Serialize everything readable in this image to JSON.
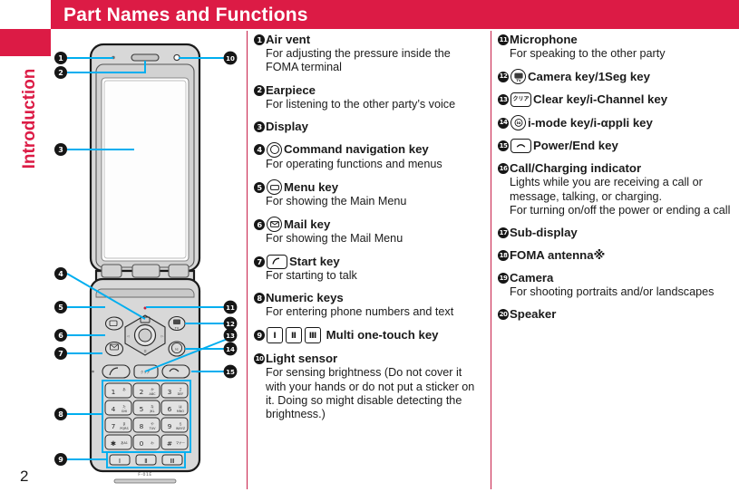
{
  "header": {
    "title": "Part Names and Functions"
  },
  "sidebar": {
    "tab_label": "Introduction",
    "page_number": "2"
  },
  "theme": {
    "accent": "#DC1B45",
    "callout_line": "#00AEEF",
    "bullet_bg": "#161616",
    "body_gray": "#D9D9D9"
  },
  "columns": {
    "middle": [
      {
        "num": "1",
        "title": "Air vent",
        "desc": "For adjusting the pressure inside the FOMA terminal",
        "icon": ""
      },
      {
        "num": "2",
        "title": "Earpiece",
        "desc": "For listening to the other party’s voice",
        "icon": ""
      },
      {
        "num": "3",
        "title": "Display",
        "desc": "",
        "icon": ""
      },
      {
        "num": "4",
        "title": "Command navigation key",
        "desc": "For operating functions and menus",
        "icon": "command-navigation-key-glyph"
      },
      {
        "num": "5",
        "title": "Menu key",
        "desc": "For showing the Main Menu",
        "icon": "menu-key-glyph"
      },
      {
        "num": "6",
        "title": "Mail key",
        "desc": "For showing the Mail Menu",
        "icon": "mail-key-glyph"
      },
      {
        "num": "7",
        "title": "Start key",
        "desc": "For starting to talk",
        "icon": "start-key-glyph"
      },
      {
        "num": "8",
        "title": "Numeric keys",
        "desc": "For entering phone numbers and text",
        "icon": ""
      },
      {
        "num": "9",
        "title": "Multi one-touch key",
        "desc": "",
        "icon": "multi-one-touch-key-glyph",
        "glyph_labels": [
          "Ⅰ",
          "Ⅱ",
          "Ⅲ"
        ]
      },
      {
        "num": "10",
        "title": "Light sensor",
        "desc": "For sensing brightness (Do not cover it with your hands or do not put a sticker on it. Doing so might disable detecting the brightness.)",
        "icon": ""
      }
    ],
    "right": [
      {
        "num": "11",
        "title": "Microphone",
        "desc": "For speaking to the other party",
        "icon": ""
      },
      {
        "num": "12",
        "title": "Camera key/1Seg key",
        "desc": "",
        "icon": "camera-key-glyph",
        "glyph_text": "TV"
      },
      {
        "num": "13",
        "title": "Clear key/i-Channel key",
        "desc": "",
        "icon": "clear-key-glyph",
        "glyph_text": "クリア"
      },
      {
        "num": "14",
        "title": "i-mode key/i-αppli key",
        "desc": "",
        "icon": "i-mode-key-glyph"
      },
      {
        "num": "15",
        "title": "Power/End key",
        "desc": "",
        "icon": "power-end-key-glyph"
      },
      {
        "num": "16",
        "title": "Call/Charging indicator",
        "desc": "Lights while you are receiving a call or message, talking, or charging.\nFor turning on/off the power or ending a call",
        "icon": ""
      },
      {
        "num": "17",
        "title": "Sub-display",
        "desc": "",
        "icon": ""
      },
      {
        "num": "18",
        "title": "FOMA antenna※",
        "desc": "",
        "icon": ""
      },
      {
        "num": "19",
        "title": "Camera",
        "desc": "For shooting portraits and/or landscapes",
        "icon": ""
      },
      {
        "num": "20",
        "title": "Speaker",
        "desc": "",
        "icon": ""
      }
    ]
  },
  "illustration": {
    "alt": "Mobile phone front view with numbered callouts 1 through 15",
    "model_label": "F-01E",
    "callouts_left": [
      "1",
      "2",
      "3",
      "4",
      "5",
      "6",
      "7",
      "8",
      "9"
    ],
    "callouts_right": [
      "10",
      "11",
      "12",
      "13",
      "14",
      "15"
    ],
    "keypad": [
      {
        "digit": "1",
        "kana": "あ",
        "latin": ""
      },
      {
        "digit": "2",
        "kana": "か",
        "latin": "ABC"
      },
      {
        "digit": "3",
        "kana": "さ",
        "latin": "DEF"
      },
      {
        "digit": "4",
        "kana": "た",
        "latin": "GHI"
      },
      {
        "digit": "5",
        "kana": "な",
        "latin": "JKL"
      },
      {
        "digit": "6",
        "kana": "は",
        "latin": "MNO"
      },
      {
        "digit": "7",
        "kana": "ま",
        "latin": "PQRS"
      },
      {
        "digit": "8",
        "kana": "や",
        "latin": "TUV"
      },
      {
        "digit": "9",
        "kana": "ら",
        "latin": "WXYZ"
      },
      {
        "digit": "✳",
        "kana": "",
        "latin": ""
      },
      {
        "digit": "0",
        "kana": "わ",
        "latin": ""
      },
      {
        "digit": "#",
        "kana": "",
        "latin": ""
      }
    ],
    "multi_keys": [
      "Ⅰ",
      "Ⅱ",
      "Ⅲ"
    ]
  }
}
